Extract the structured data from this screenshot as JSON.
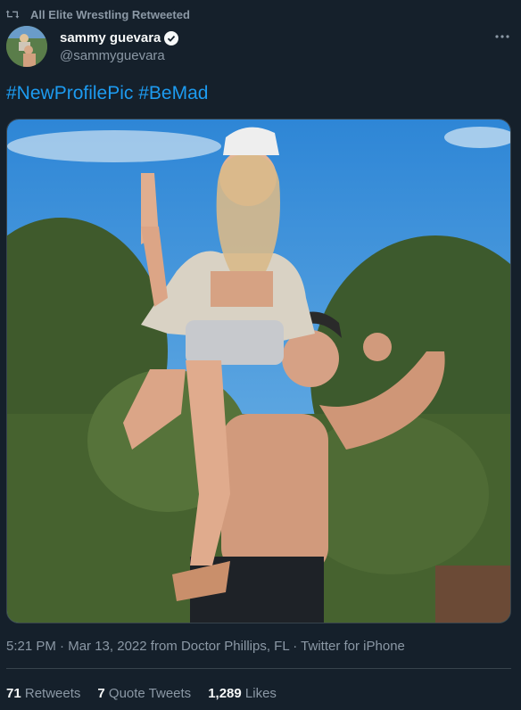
{
  "retweet": {
    "text": "All Elite Wrestling Retweeted",
    "icon": "retweet-icon"
  },
  "author": {
    "name": "sammy guevara",
    "handle": "@sammyguevara",
    "verified": true
  },
  "tweet": {
    "hashtags": [
      "#NewProfilePic",
      "#BeMad"
    ],
    "photo_subject": "photo"
  },
  "meta": {
    "time": "5:21 PM",
    "date": "Mar 13, 2022",
    "from_prefix": "from",
    "location": "Doctor Phillips, FL",
    "source": "Twitter for iPhone"
  },
  "stats": {
    "retweets_count": "71",
    "retweets_label": "Retweets",
    "quotes_count": "7",
    "quotes_label": "Quote Tweets",
    "likes_count": "1,289",
    "likes_label": "Likes"
  },
  "colors": {
    "background": "#15202b",
    "accent": "#1d9bf0",
    "secondary_text": "#8b98a5",
    "primary_text": "#f7f9f9",
    "divider": "#38444d"
  }
}
